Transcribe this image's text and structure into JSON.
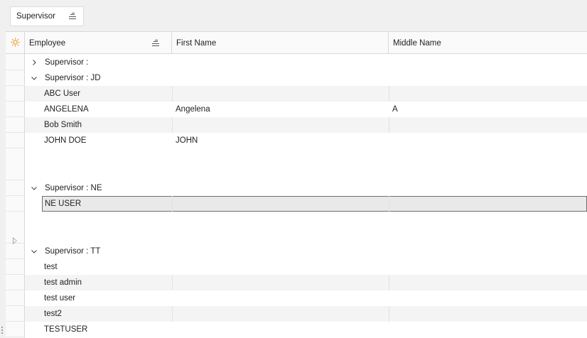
{
  "group_panel": {
    "chip_label": "Supervisor"
  },
  "columns": {
    "employee": "Employee",
    "first_name": "First Name",
    "middle_name": "Middle Name"
  },
  "groups": [
    {
      "label": "Supervisor :",
      "expanded": false,
      "rows": []
    },
    {
      "label": "Supervisor : JD",
      "expanded": true,
      "rows": [
        {
          "employee": "ABC User",
          "first_name": "",
          "middle_name": ""
        },
        {
          "employee": "ANGELENA",
          "first_name": "Angelena",
          "middle_name": "A"
        },
        {
          "employee": "Bob Smith",
          "first_name": "",
          "middle_name": ""
        },
        {
          "employee": "JOHN DOE",
          "first_name": "JOHN",
          "middle_name": ""
        }
      ]
    },
    {
      "label": "Supervisor : NE",
      "expanded": true,
      "rows": [
        {
          "employee": "NE USER",
          "first_name": "",
          "middle_name": "",
          "selected": true
        }
      ]
    },
    {
      "label": "Supervisor : TT",
      "expanded": true,
      "rows": [
        {
          "employee": "test",
          "first_name": "",
          "middle_name": ""
        },
        {
          "employee": "test admin",
          "first_name": "",
          "middle_name": ""
        },
        {
          "employee": "test user",
          "first_name": "",
          "middle_name": ""
        },
        {
          "employee": "test2",
          "first_name": "",
          "middle_name": ""
        },
        {
          "employee": "TESTUSER",
          "first_name": "",
          "middle_name": ""
        }
      ]
    }
  ],
  "colors": {
    "accent_icon": "#f0a030",
    "selection_border": "#6e6e6e",
    "alt_row": "#f4f4f4"
  },
  "icons": {
    "indicator_header": "sun-icon",
    "sort": "sort-icon",
    "collapsed": "chevron-right-icon",
    "expanded": "chevron-down-icon",
    "row_pointer": "triangle-right-icon"
  }
}
